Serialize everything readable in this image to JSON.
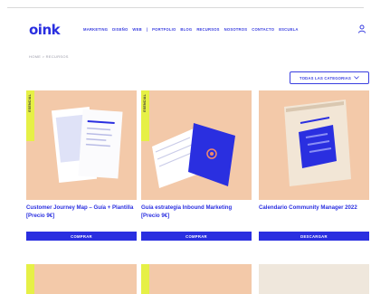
{
  "brand": {
    "logo_text": "oink",
    "accent": "#2a2fe0",
    "tag_color": "#e6f046",
    "thumb_color": "#f3c9a9"
  },
  "nav": {
    "items": [
      "MARKETING",
      "DISEÑO",
      "WEB",
      "|",
      "PORTFOLIO",
      "BLOG",
      "RECURSOS",
      "NOSOTROS",
      "CONTACTO",
      "ESCUELA"
    ]
  },
  "breadcrumb": "HOME > RECURSOS",
  "filter": {
    "label": "TODAS LAS CATEGORIAS"
  },
  "cards": [
    {
      "tag": "ESENCIAL",
      "title": "Customer Journey Map – Guía + Plantilla [Precio 9€]",
      "button": "COMPRAR"
    },
    {
      "tag": "ESENCIAL",
      "title": "Guía estrategia Inbound Marketing [Precio 9€]",
      "button": "COMPRAR"
    },
    {
      "tag": "",
      "title": "Calendario Community Manager 2022",
      "button": "DESCARGAR"
    }
  ]
}
